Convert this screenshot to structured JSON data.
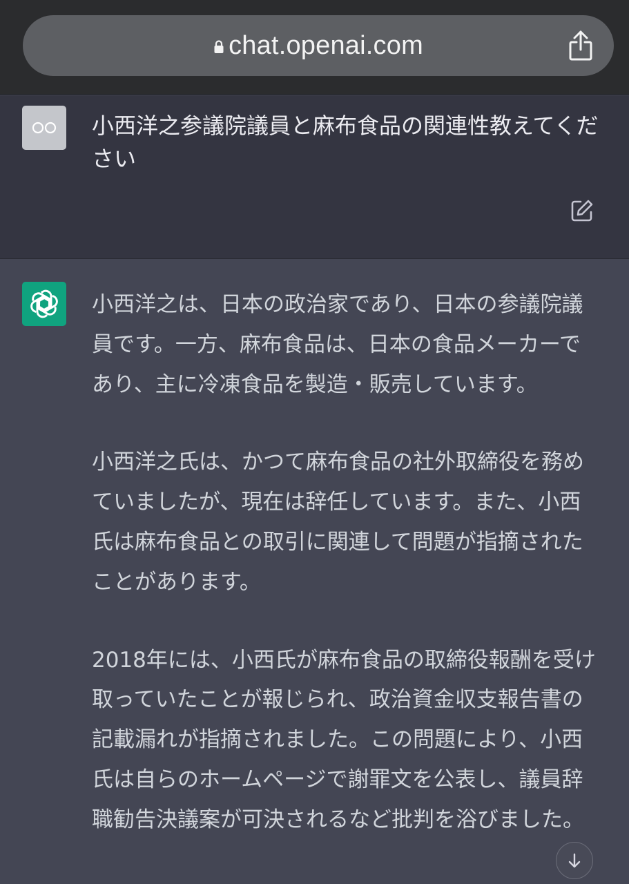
{
  "browser": {
    "url": "chat.openai.com",
    "icons": {
      "lock": "lock-icon",
      "share": "share-icon"
    }
  },
  "user_message": {
    "avatar_text": "OO",
    "text": "小西洋之参議院議員と麻布食品の関連性教えてください",
    "icon": "edit-icon"
  },
  "assistant_message": {
    "avatar_icon": "openai-logo-icon",
    "paragraphs": [
      "小西洋之は、日本の政治家であり、日本の参議院議員です。一方、麻布食品は、日本の食品メーカーであり、主に冷凍食品を製造・販売しています。",
      "小西洋之氏は、かつて麻布食品の社外取締役を務めていましたが、現在は辞任しています。また、小西氏は麻布食品との取引に関連して問題が指摘されたことがあります。",
      "2018年には、小西氏が麻布食品の取締役報酬を受け取っていたことが報じられ、政治資金収支報告書の記載漏れが指摘されました。この問題により、小西氏は自らのホームページで謝罪文を公表し、議員辞職勧告決議案が可決されるなど批判を浴びました。"
    ]
  },
  "scroll_button": {
    "icon": "arrow-down-icon"
  },
  "colors": {
    "browser_bar": "#2b2c2e",
    "url_pill": "#5d5f63",
    "user_bg": "#343541",
    "assistant_bg": "#444654",
    "gpt_green": "#10a37f",
    "assistant_text": "#d1d5db",
    "user_text": "#ececf1"
  }
}
